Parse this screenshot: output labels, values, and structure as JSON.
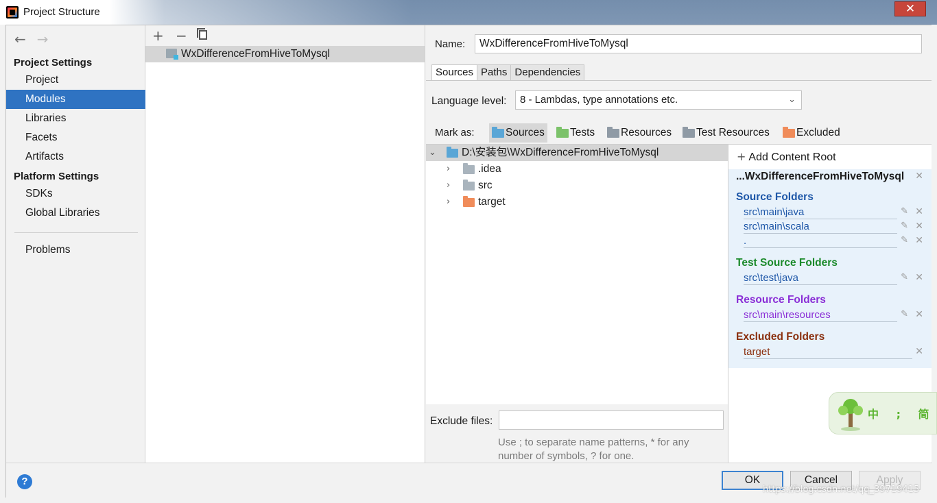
{
  "window": {
    "title": "Project Structure",
    "close_glyph": "✕"
  },
  "nav": {
    "back_glyph": "←",
    "forward_glyph": "→",
    "project_settings_heading": "Project Settings",
    "project_settings_items": [
      "Project",
      "Modules",
      "Libraries",
      "Facets",
      "Artifacts"
    ],
    "platform_settings_heading": "Platform Settings",
    "platform_settings_items": [
      "SDKs",
      "Global Libraries"
    ],
    "problems": "Problems",
    "selected": "Modules"
  },
  "module_list": {
    "add_glyph": "+",
    "remove_glyph": "−",
    "modules": [
      "WxDifferenceFromHiveToMysql"
    ]
  },
  "module": {
    "name_label": "Name:",
    "name_value": "WxDifferenceFromHiveToMysql",
    "tabs": [
      "Sources",
      "Paths",
      "Dependencies"
    ],
    "active_tab": "Sources",
    "language_level_label": "Language level:",
    "language_level_value": "8 - Lambdas, type annotations etc.",
    "mark_as_label": "Mark as:",
    "mark_as_options": [
      "Sources",
      "Tests",
      "Resources",
      "Test Resources",
      "Excluded"
    ]
  },
  "tree": {
    "root": "D:\\安装包\\WxDifferenceFromHiveToMysql",
    "children": [
      ".idea",
      "src",
      "target"
    ],
    "expanded_glyph": "⌄",
    "collapsed_glyph": "›"
  },
  "exclude": {
    "label": "Exclude files:",
    "value": "",
    "hint": "Use ; to separate name patterns, * for any number of symbols, ? for one."
  },
  "content_root": {
    "add_label": "Add Content Root",
    "root_title": "...WxDifferenceFromHiveToMysql",
    "source_folders_title": "Source Folders",
    "source_folders": [
      "src\\main\\java",
      "src\\main\\scala",
      "."
    ],
    "test_source_folders_title": "Test Source Folders",
    "test_source_folders": [
      "src\\test\\java"
    ],
    "resource_folders_title": "Resource Folders",
    "resource_folders": [
      "src\\main\\resources"
    ],
    "excluded_folders_title": "Excluded Folders",
    "excluded_folders": [
      "target"
    ]
  },
  "widget": {
    "text": "中 ; 简"
  },
  "buttons": {
    "help": "?",
    "ok": "OK",
    "cancel": "Cancel",
    "apply": "Apply"
  },
  "watermark": "https://blog.csdn.net/qq_39719415",
  "colors": {
    "selection": "#2f73c2",
    "sources_folder": "#5aa6d6",
    "tests_folder": "#7cc26a",
    "resources_folder": "#8f9aa5",
    "excluded_folder": "#f08c5a",
    "source_folders_title": "#1e57a8",
    "test_source_folders_title": "#1b8a2a",
    "resource_folders_title": "#8a2ed6",
    "excluded_folders_title": "#8a2f0e"
  }
}
